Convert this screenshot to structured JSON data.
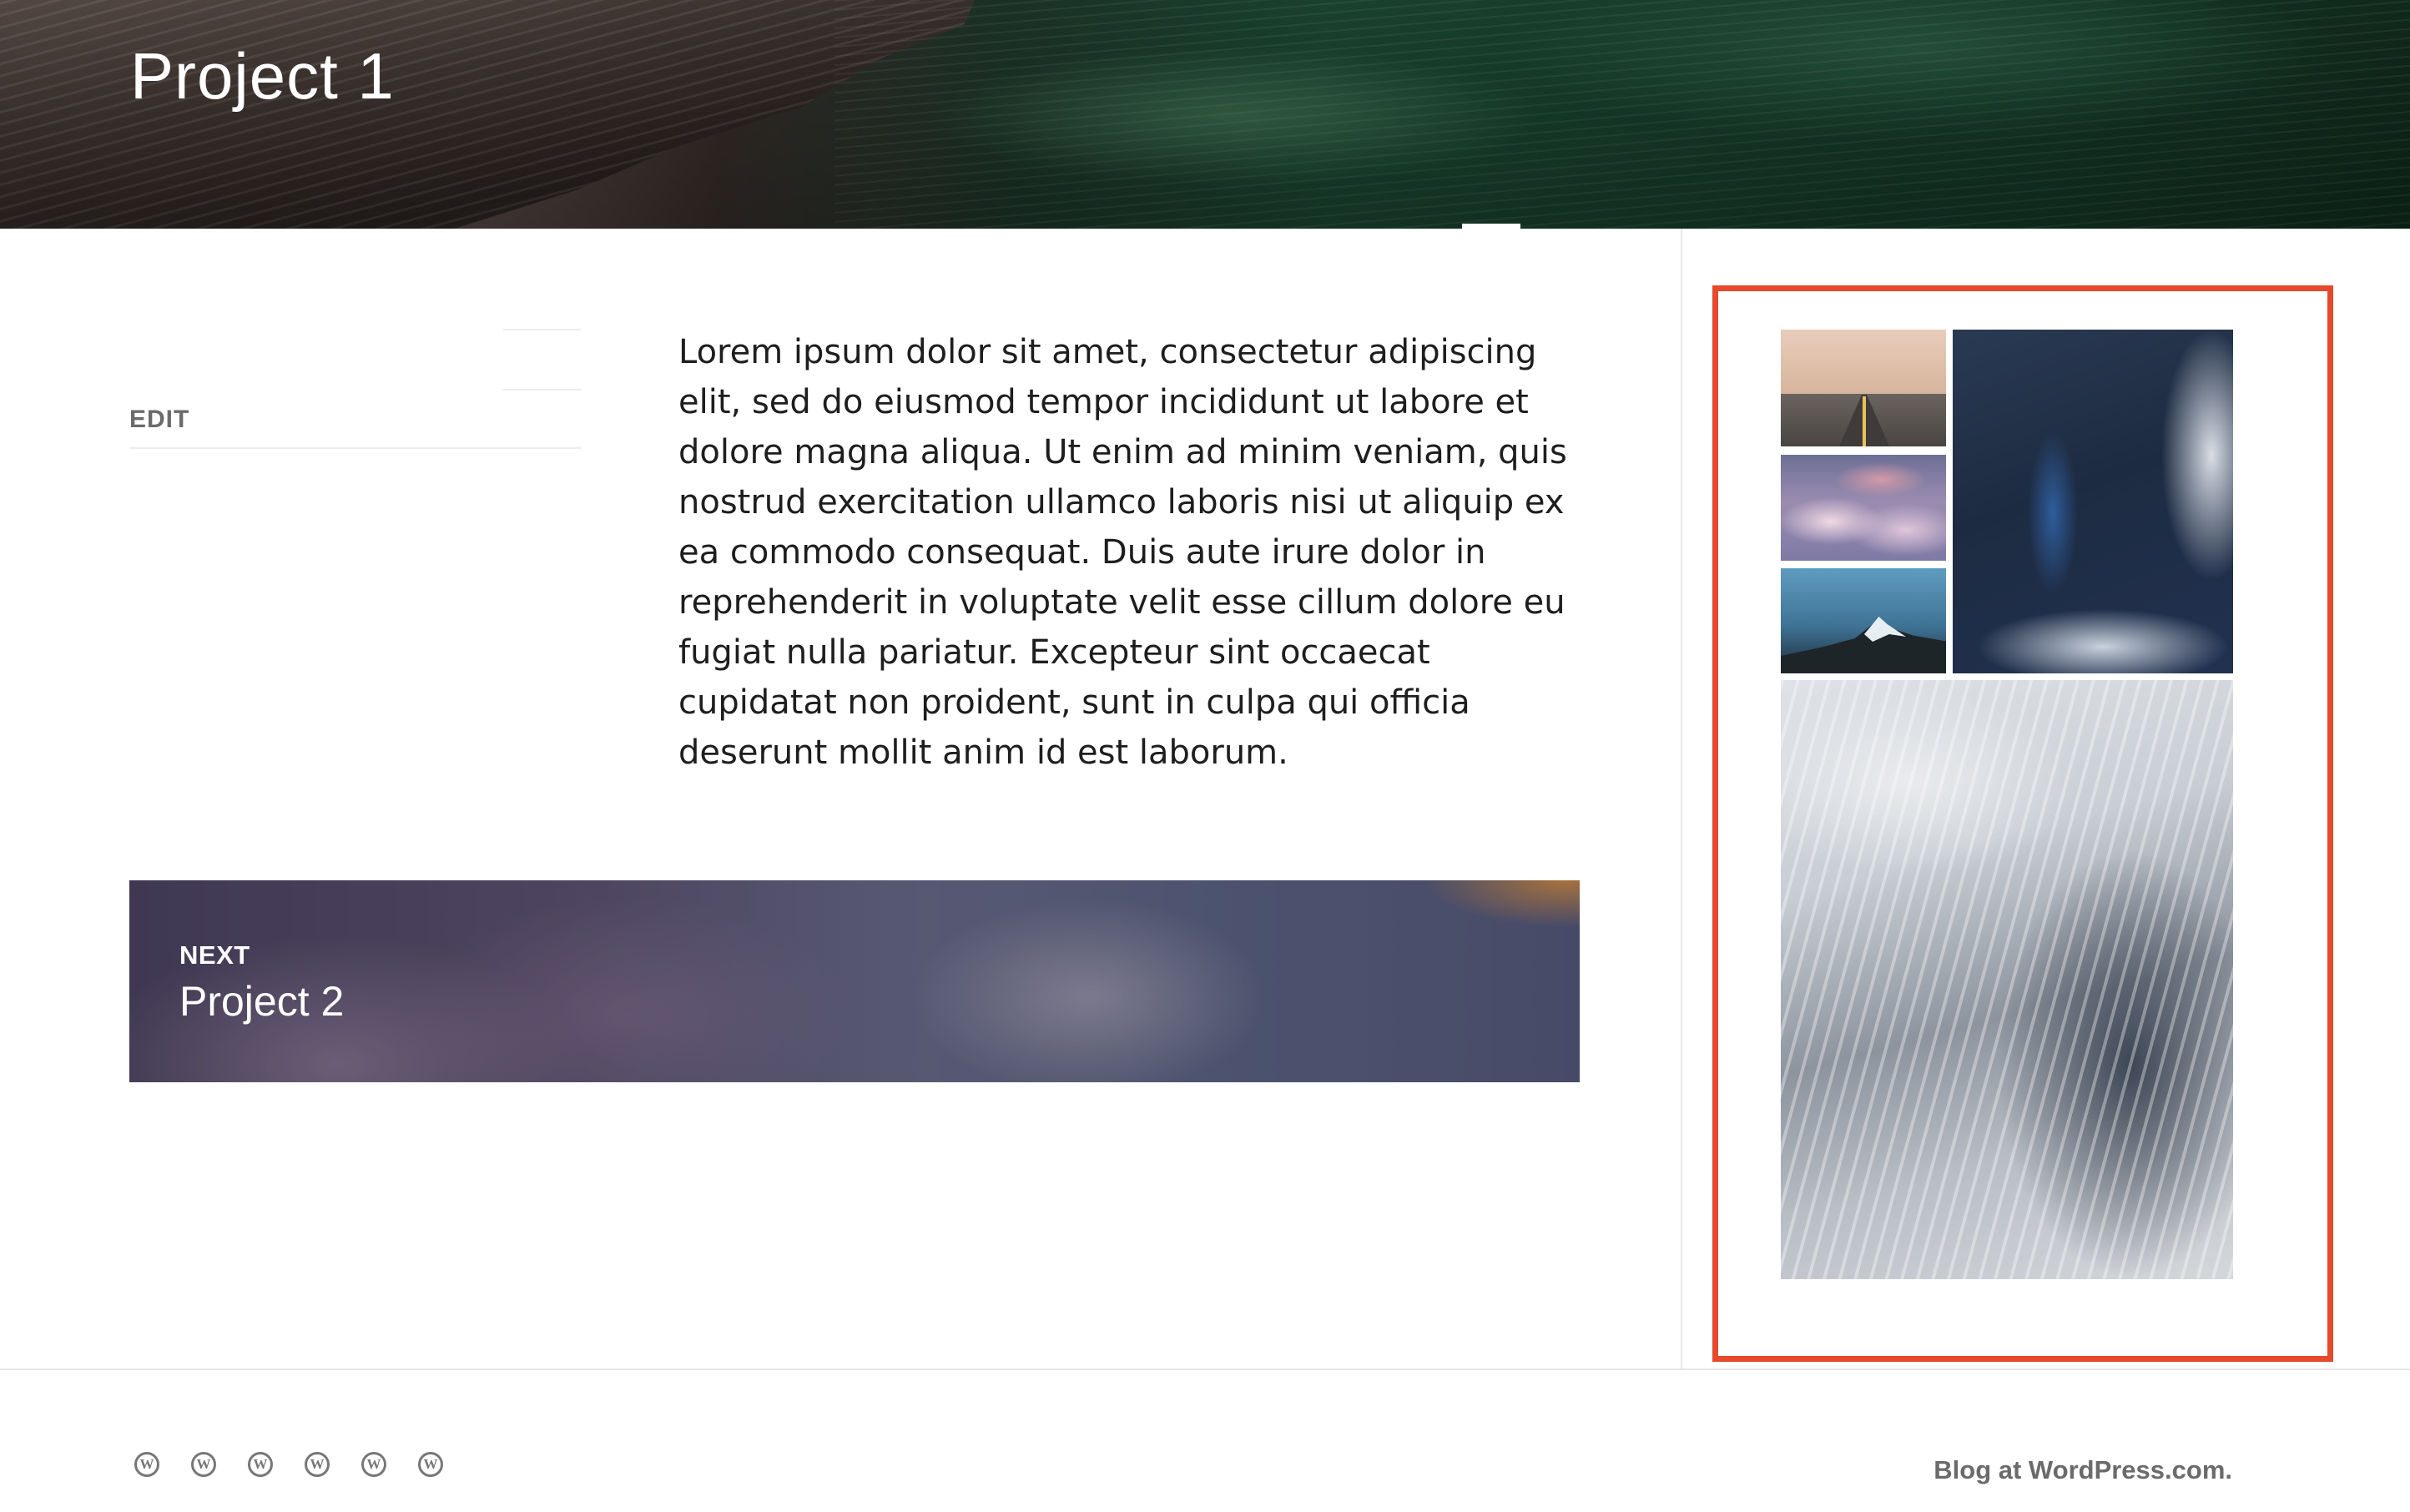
{
  "header": {
    "title": "Project 1"
  },
  "entry_meta": {
    "edit_label": "EDIT"
  },
  "entry": {
    "content": "Lorem ipsum dolor sit amet, consectetur adipiscing elit, sed do eiusmod tempor incididunt ut labore et dolore magna aliqua. Ut enim ad minim veniam, quis nostrud exercitation ullamco laboris nisi ut aliquip ex ea commodo consequat. Duis aute irure dolor in reprehenderit in voluptate velit esse cillum dolore eu fugiat nulla pariatur. Excepteur sint occaecat cupidatat non proident, sunt in culpa qui officia deserunt mollit anim id est laborum."
  },
  "post_navigation": {
    "label": "NEXT",
    "title": "Project 2"
  },
  "sidebar": {
    "highlight_color": "#e6492b",
    "gallery": [
      {
        "name": "road",
        "description_icon": "photo"
      },
      {
        "name": "clouds",
        "description_icon": "photo"
      },
      {
        "name": "mountain",
        "description_icon": "photo"
      },
      {
        "name": "ocean-aerial",
        "description_icon": "photo"
      },
      {
        "name": "ice-aerial",
        "description_icon": "photo"
      }
    ]
  },
  "footer": {
    "social_icons": [
      "wordpress-icon",
      "wordpress-icon",
      "wordpress-icon",
      "wordpress-icon",
      "wordpress-icon",
      "wordpress-icon"
    ],
    "credit": "Blog at WordPress.com."
  }
}
